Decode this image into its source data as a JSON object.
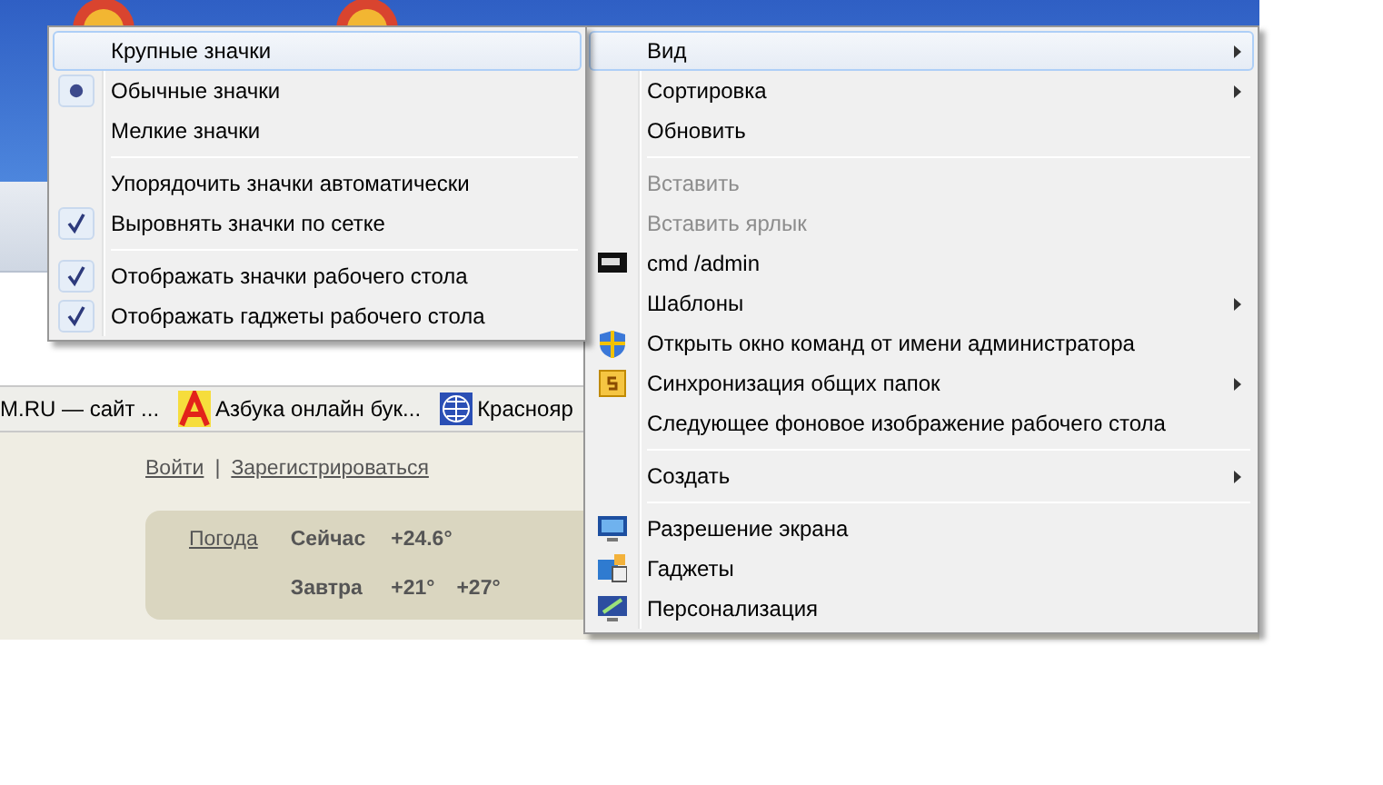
{
  "browser": {
    "bookmarks": [
      {
        "label": "M.RU — сайт ..."
      },
      {
        "label": "Азбука онлайн бук..."
      },
      {
        "label": "Краснояр"
      }
    ],
    "auth_links": [
      {
        "label": "Войти"
      },
      {
        "label": "Зарегистрироваться"
      }
    ],
    "auth_separator": "|",
    "weather": {
      "link": "Погода",
      "rows": [
        {
          "label": "Сейчас",
          "values": [
            "+24.6°"
          ]
        },
        {
          "label": "Завтра",
          "values": [
            "+21°",
            "+27°"
          ]
        }
      ]
    }
  },
  "view_submenu": {
    "items": [
      {
        "kind": "radio",
        "label": "Крупные значки",
        "selected": false,
        "highlighted": true
      },
      {
        "kind": "radio",
        "label": "Обычные значки",
        "selected": true,
        "highlighted": false
      },
      {
        "kind": "radio",
        "label": "Мелкие значки",
        "selected": false,
        "highlighted": false
      },
      {
        "kind": "separator"
      },
      {
        "kind": "check",
        "label": "Упорядочить значки автоматически",
        "checked": false,
        "highlighted": false
      },
      {
        "kind": "check",
        "label": "Выровнять значки по сетке",
        "checked": true,
        "highlighted": false
      },
      {
        "kind": "separator"
      },
      {
        "kind": "check",
        "label": "Отображать значки рабочего стола",
        "checked": true,
        "highlighted": false
      },
      {
        "kind": "check",
        "label": "Отображать гаджеты  рабочего стола",
        "checked": true,
        "highlighted": false
      }
    ]
  },
  "context_menu": {
    "items": [
      {
        "kind": "item",
        "label": "Вид",
        "submenu": true,
        "disabled": false,
        "highlighted": true
      },
      {
        "kind": "item",
        "label": "Сортировка",
        "submenu": true,
        "disabled": false,
        "highlighted": false
      },
      {
        "kind": "item",
        "label": "Обновить",
        "submenu": false,
        "disabled": false,
        "highlighted": false
      },
      {
        "kind": "separator"
      },
      {
        "kind": "item",
        "label": "Вставить",
        "submenu": false,
        "disabled": true,
        "highlighted": false
      },
      {
        "kind": "item",
        "label": "Вставить ярлык",
        "submenu": false,
        "disabled": true,
        "highlighted": false
      },
      {
        "kind": "item",
        "label": "cmd /admin",
        "submenu": false,
        "disabled": false,
        "highlighted": false
      },
      {
        "kind": "item",
        "label": "Шаблоны",
        "submenu": true,
        "disabled": false,
        "highlighted": false
      },
      {
        "kind": "item",
        "label": "Открыть окно команд от имени администратора",
        "submenu": false,
        "disabled": false,
        "highlighted": false
      },
      {
        "kind": "item",
        "label": "Синхронизация общих папок",
        "submenu": true,
        "disabled": false,
        "highlighted": false
      },
      {
        "kind": "item",
        "label": "Следующее фоновое изображение рабочего стола",
        "submenu": false,
        "disabled": false,
        "highlighted": false
      },
      {
        "kind": "separator"
      },
      {
        "kind": "item",
        "label": "Создать",
        "submenu": true,
        "disabled": false,
        "highlighted": false
      },
      {
        "kind": "separator"
      },
      {
        "kind": "item",
        "label": "Разрешение экрана",
        "submenu": false,
        "disabled": false,
        "highlighted": false
      },
      {
        "kind": "item",
        "label": "Гаджеты",
        "submenu": false,
        "disabled": false,
        "highlighted": false
      },
      {
        "kind": "item",
        "label": "Персонализация",
        "submenu": false,
        "disabled": false,
        "highlighted": false
      }
    ]
  }
}
